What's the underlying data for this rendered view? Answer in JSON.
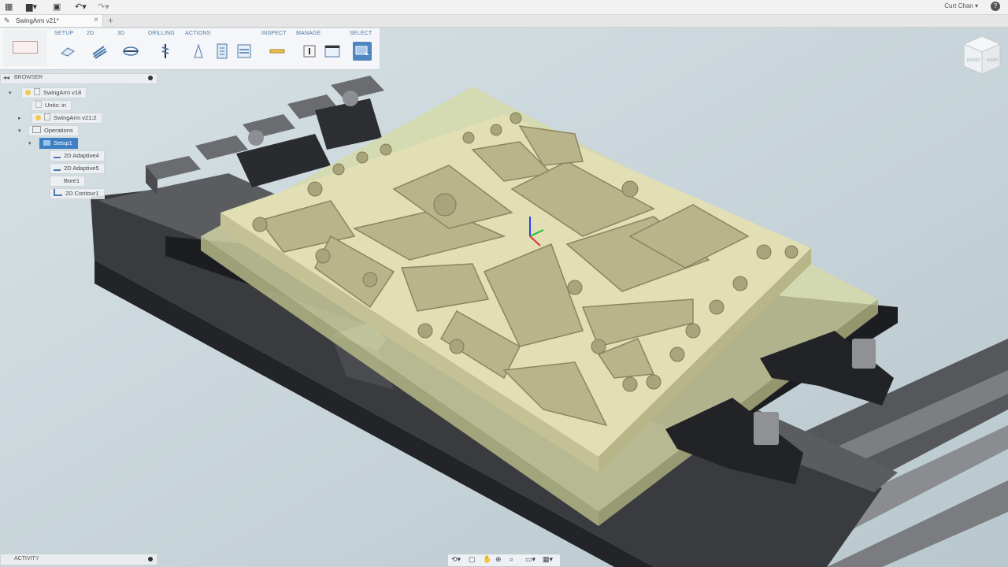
{
  "app": {
    "user_name": "Curt Chan",
    "help_label": "?",
    "icons": [
      "grid-menu-icon",
      "file-icon",
      "save-icon",
      "undo-icon",
      "redo-icon"
    ]
  },
  "document_tab": {
    "title": "SwingArm v21*",
    "close_glyph": "×",
    "new_tab_glyph": "+"
  },
  "toolbar": {
    "groups": [
      {
        "id": "setup",
        "label": "SETUP"
      },
      {
        "id": "2d",
        "label": "2D"
      },
      {
        "id": "3d",
        "label": "3D"
      },
      {
        "id": "drilling",
        "label": "DRILLING"
      },
      {
        "id": "actions",
        "label": "ACTIONS"
      },
      {
        "id": "inspect",
        "label": "INSPECT"
      },
      {
        "id": "manage",
        "label": "MANAGE"
      },
      {
        "id": "select",
        "label": "SELECT"
      }
    ]
  },
  "browser": {
    "title": "BROWSER",
    "nodes": [
      {
        "id": "root",
        "label": "SwingArm v18"
      },
      {
        "id": "units",
        "label": "Units: in"
      },
      {
        "id": "component",
        "label": "SwingArm v21:2"
      },
      {
        "id": "operations",
        "label": "Operations"
      },
      {
        "id": "setup1",
        "label": "Setup1",
        "selected": true
      },
      {
        "id": "op1",
        "label": "2D Adaptive4"
      },
      {
        "id": "op2",
        "label": "2D Adaptive5"
      },
      {
        "id": "op3",
        "label": "Bore1"
      },
      {
        "id": "op4",
        "label": "2D Contour1"
      }
    ]
  },
  "activity": {
    "title": "ACTIVITY"
  },
  "view_cube": {
    "faces": [
      "FRONT",
      "RIGHT"
    ]
  },
  "colors": {
    "accent": "#3d7fc4",
    "part": "#dedbb0",
    "stock": "#c8cc90",
    "vise": "#2c2d30",
    "background": "#c9d6db"
  }
}
